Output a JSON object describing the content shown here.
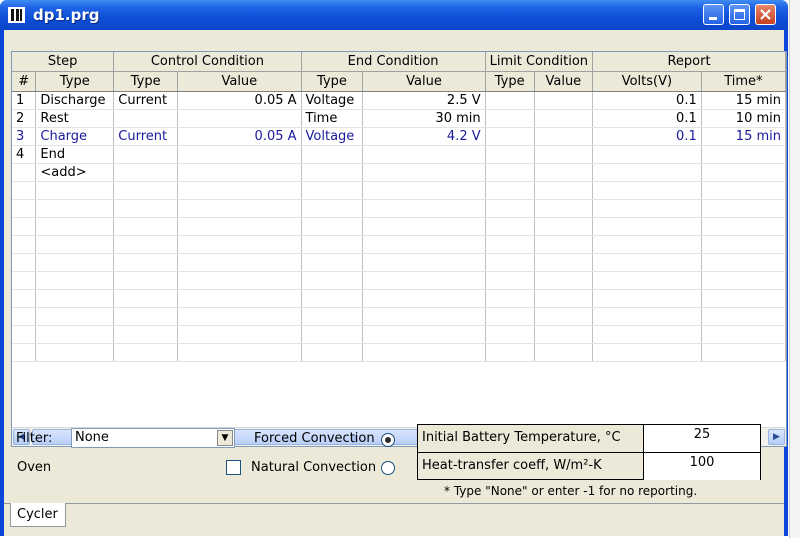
{
  "window": {
    "title": "dp1.prg"
  },
  "grid": {
    "group_headers": [
      "Step",
      "Control Condition",
      "End Condition",
      "Limit Condition",
      "Report"
    ],
    "column_headers": [
      "#",
      "Type",
      "Type",
      "Value",
      "Type",
      "Value",
      "Type",
      "Value",
      "Volts(V)",
      "Time*"
    ],
    "rows": [
      {
        "num": "1",
        "step_type": "Discharge",
        "control_type": "Current",
        "control_value": "0.05 A",
        "end_type": "Voltage",
        "end_value": "2.5 V",
        "limit_type": "",
        "limit_value": "",
        "volts": "0.1",
        "time": "15 min",
        "highlight": false
      },
      {
        "num": "2",
        "step_type": "Rest",
        "control_type": "",
        "control_value": "",
        "end_type": "Time",
        "end_value": "30 min",
        "limit_type": "",
        "limit_value": "",
        "volts": "0.1",
        "time": "10 min",
        "highlight": false
      },
      {
        "num": "3",
        "step_type": "Charge",
        "control_type": "Current",
        "control_value": "0.05 A",
        "end_type": "Voltage",
        "end_value": "4.2 V",
        "limit_type": "",
        "limit_value": "",
        "volts": "0.1",
        "time": "15 min",
        "highlight": true
      },
      {
        "num": "4",
        "step_type": "End",
        "control_type": "",
        "control_value": "",
        "end_type": "",
        "end_value": "",
        "limit_type": "",
        "limit_value": "",
        "volts": "",
        "time": "",
        "highlight": false
      },
      {
        "num": "",
        "step_type": "<add>",
        "control_type": "",
        "control_value": "",
        "end_type": "",
        "end_value": "",
        "limit_type": "",
        "limit_value": "",
        "volts": "",
        "time": "",
        "highlight": false
      }
    ]
  },
  "filter": {
    "label": "Filter:",
    "value": "None"
  },
  "oven": {
    "label": "Oven"
  },
  "convection": {
    "forced_label": "Forced Convection",
    "natural_label": "Natural Convection",
    "selected": "forced"
  },
  "params": {
    "initial_temp_label": "Initial Battery Temperature, °C",
    "initial_temp_value": "25",
    "htc_label": "Heat-transfer coeff, W/m²-K",
    "htc_value": "100"
  },
  "note": "*  Type \"None\" or enter -1 for no reporting.",
  "tabs": [
    {
      "label": "Cycler",
      "active": true
    }
  ],
  "colors": {
    "highlight_text": "#1a1a9c",
    "titlebar": "#0a45c9"
  }
}
